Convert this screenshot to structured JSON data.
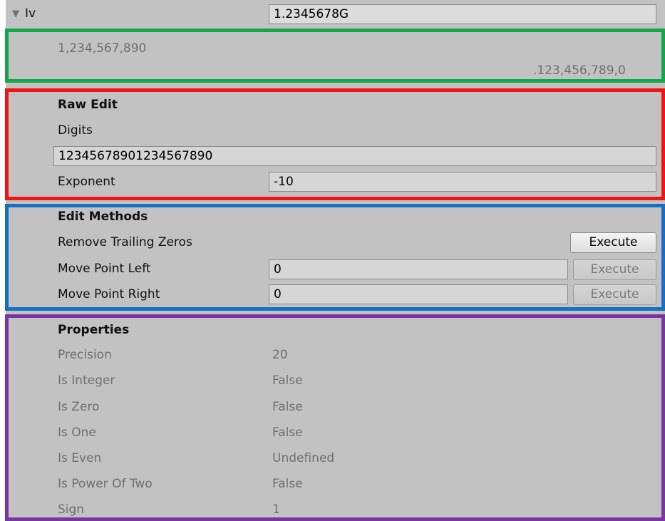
{
  "header": {
    "foldout_glyph": "▼",
    "label": "Iv",
    "value": "1.2345678G"
  },
  "formatted": {
    "grouped": "1,234,567,890",
    "fraction": ".123,456,789,0"
  },
  "raw_edit": {
    "title": "Raw Edit",
    "digits_label": "Digits",
    "digits_value": "12345678901234567890",
    "exponent_label": "Exponent",
    "exponent_value": "-10"
  },
  "edit_methods": {
    "title": "Edit Methods",
    "remove_trailing_zeros": {
      "label": "Remove Trailing Zeros",
      "button": "Execute"
    },
    "move_point_left": {
      "label": "Move Point Left",
      "value": "0",
      "button": "Execute"
    },
    "move_point_right": {
      "label": "Move Point Right",
      "value": "0",
      "button": "Execute"
    }
  },
  "properties": {
    "title": "Properties",
    "rows": [
      {
        "label": "Precision",
        "value": "20"
      },
      {
        "label": "Is Integer",
        "value": "False"
      },
      {
        "label": "Is Zero",
        "value": "False"
      },
      {
        "label": "Is One",
        "value": "False"
      },
      {
        "label": "Is Even",
        "value": "Undefined"
      },
      {
        "label": "Is Power Of Two",
        "value": "False"
      },
      {
        "label": "Sign",
        "value": "1"
      }
    ]
  },
  "highlight_colors": {
    "formatted": "#13a64a",
    "raw_edit": "#f01414",
    "edit_methods": "#1670c2",
    "properties": "#7a35a3"
  }
}
